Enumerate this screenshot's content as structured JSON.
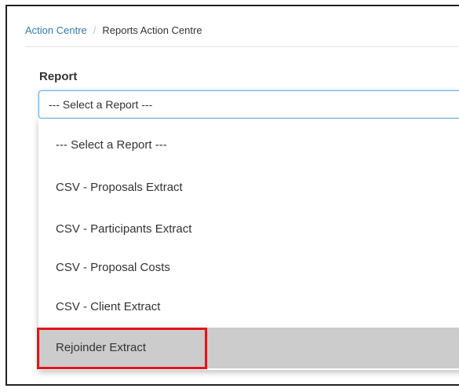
{
  "breadcrumb": {
    "parent": "Action Centre",
    "separator": "/",
    "current": "Reports Action Centre"
  },
  "report_field": {
    "label": "Report",
    "selected_value": "--- Select a Report ---"
  },
  "dropdown": {
    "options": [
      {
        "label": "--- Select a Report ---",
        "highlighted": false
      },
      {
        "label": "CSV - Proposals Extract",
        "highlighted": false
      },
      {
        "label": "CSV - Participants Extract",
        "highlighted": false
      },
      {
        "label": "CSV - Proposal Costs",
        "highlighted": false
      },
      {
        "label": "CSV - Client Extract",
        "highlighted": false
      },
      {
        "label": "Rejoinder Extract",
        "highlighted": true
      }
    ]
  },
  "colors": {
    "link": "#337ab7",
    "option_highlight": "#cccccc",
    "annotation_border": "#e3141b",
    "focus_border": "#66afe9"
  }
}
